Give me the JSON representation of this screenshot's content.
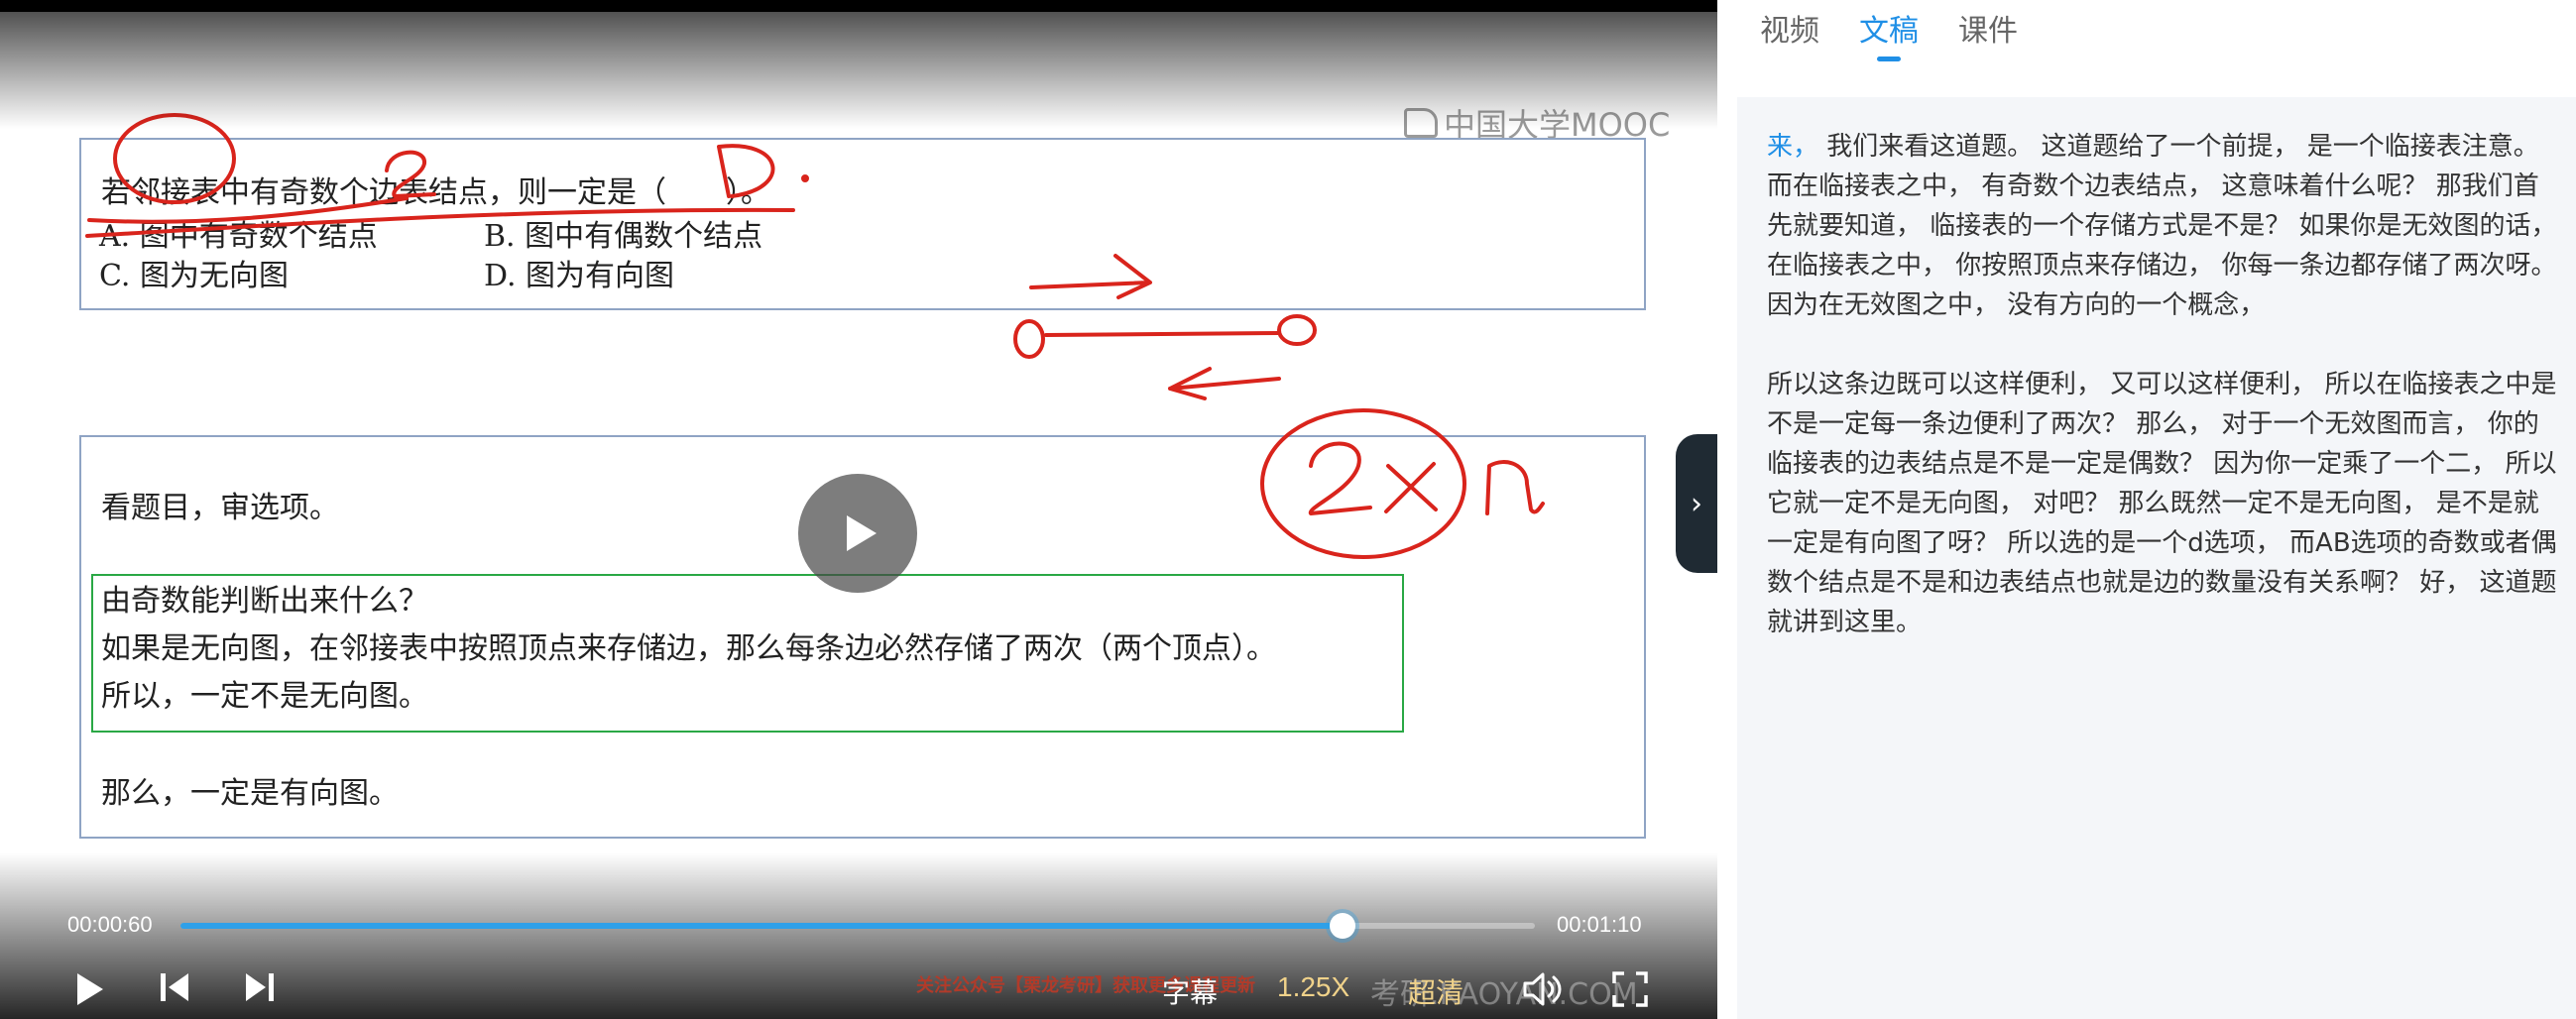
{
  "slide": {
    "logo_text": "中国大学MOOC",
    "question": {
      "stem": "若邻接表中有奇数个边表结点，则一定是（　　）。",
      "option_a": "A.  图中有奇数个结点",
      "option_b": "B.  图中有偶数个结点",
      "option_c": "C.  图为无向图",
      "option_d": "D.  图为有向图"
    },
    "analysis": {
      "line1": "看题目，审选项。",
      "line2": "由奇数能判断出来什么？",
      "line3": "如果是无向图，在邻接表中按照顶点来存储边，那么每条边必然存储了两次（两个顶点）。",
      "line4": "所以，一定不是无向图。",
      "line5": "那么，一定是有向图。"
    },
    "annotation_color": "#d9241c"
  },
  "controls": {
    "current_time": "00:00:60",
    "total_time": "00:01:10",
    "progress": 0.858,
    "subtitle_label": "字幕",
    "speed_label": "1.25X",
    "quality_label": "超清",
    "promo_text": "关注公众号【栗龙考研】获取更多课程更新",
    "corner_watermark": "考研.KAOYAN.COM",
    "accent_color": "#2fa0e8"
  },
  "tabs": [
    {
      "label": "视频",
      "active": false
    },
    {
      "label": "文稿",
      "active": true
    },
    {
      "label": "课件",
      "active": false
    }
  ],
  "transcript": {
    "highlight": "来，",
    "para1_rest": " 我们来看这道题。 这道题给了一个前提， 是一个临接表注意。 而在临接表之中， 有奇数个边表结点， 这意味着什么呢？  那我们首先就要知道， 临接表的一个存储方式是不是？ 如果你是无效图的话， 在临接表之中， 你按照顶点来存储边， 你每一条边都存储了两次呀。 因为在无效图之中， 没有方向的一个概念，",
    "para2": "所以这条边既可以这样便利， 又可以这样便利， 所以在临接表之中是不是一定每一条边便利了两次？ 那么， 对于一个无效图而言， 你的临接表的边表结点是不是一定是偶数？ 因为你一定乘了一个二， 所以它就一定不是无向图， 对吧？ 那么既然一定不是无向图， 是不是就一定是有向图了呀？ 所以选的是一个d选项，  而AB选项的奇数或者偶数个结点是不是和边表结点也就是边的数量没有关系啊？ 好， 这道题就讲到这里。"
  }
}
